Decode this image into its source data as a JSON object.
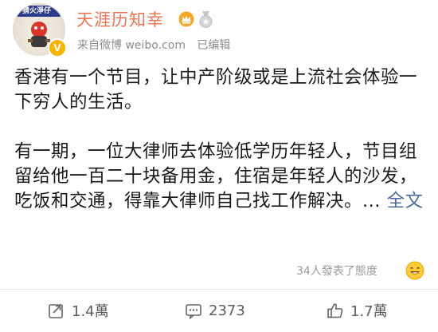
{
  "post": {
    "username": "天涯历知幸",
    "source": "来自微博 weibo.com",
    "edited": "已编辑",
    "avatar_banner": "猜火淨仔",
    "verified_badge": "V",
    "paragraph_1": "香港有一个节目，让中产阶级或是上流社会体验一下穷人的生活。",
    "paragraph_2": "有一期，一位大律师去体验低学历年轻人，节目组留给他一百二十块备用金，住宿是年轻人的沙发，吃饭和交通，得靠大律师自己找工作解决。... ",
    "full_text_link": "全文"
  },
  "reactions": {
    "text": "34人發表了態度"
  },
  "actions": {
    "repost_count": "1.4萬",
    "comment_count": "2373",
    "like_count": "1.7萬"
  },
  "colors": {
    "username": "#eb7350",
    "link": "#4d6b9e",
    "meta": "#8c8c8c"
  }
}
